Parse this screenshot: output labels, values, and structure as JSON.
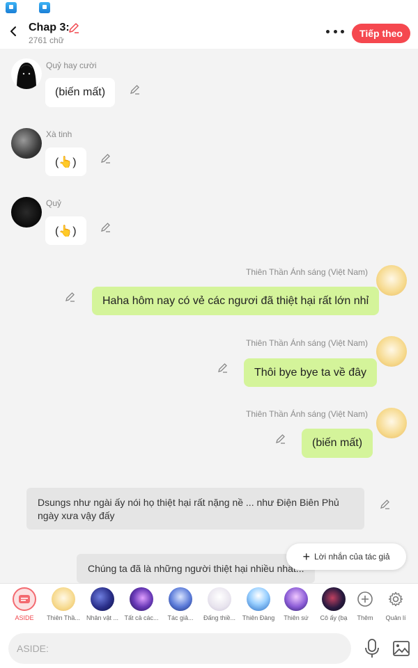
{
  "header": {
    "title": "Chap 3:",
    "word_count": "2761 chữ",
    "next_label": "Tiếp theo"
  },
  "messages": [
    {
      "side": "left",
      "sender": "Quỷ hay cười",
      "text": "(biến mất)",
      "avatar": "dark-ghost-avatar"
    },
    {
      "side": "left",
      "sender": "Xà tinh",
      "text": "(👆)",
      "avatar": "snake-spirit-avatar"
    },
    {
      "side": "left",
      "sender": "Quỷ",
      "text": "(👆)",
      "avatar": "demon-avatar"
    },
    {
      "side": "right",
      "sender": "Thiên Thần Ánh sáng (Việt Nam)",
      "text": "Haha hôm nay có vẻ các ngươi đã thiệt hại rất lớn nhỉ",
      "avatar": "angel-avatar"
    },
    {
      "side": "right",
      "sender": "Thiên Thần Ánh sáng (Việt Nam)",
      "text": "Thôi bye bye ta về đây",
      "avatar": "angel-avatar"
    },
    {
      "side": "right",
      "sender": "Thiên Thần Ánh sáng (Việt Nam)",
      "text": "(biến mất)",
      "avatar": "angel-avatar"
    }
  ],
  "asides": [
    {
      "text": "Dsungs như ngài ấy nói họ thiệt hại rất nặng nề ... như Điện Biên Phủ ngày xưa vậy đấy"
    },
    {
      "text": "Chúng ta đã là những người thiệt hại nhiều nhất..."
    }
  ],
  "author_note_label": "Lời nhắn của tác giả",
  "characters": [
    {
      "label": "ASIDE"
    },
    {
      "label": "Thiên Thầ..."
    },
    {
      "label": "Nhân vật ..."
    },
    {
      "label": "Tất cả các..."
    },
    {
      "label": "Tác giả..."
    },
    {
      "label": "Đấng thiề..."
    },
    {
      "label": "Thiên Đàng"
    },
    {
      "label": "Thiên sứ"
    },
    {
      "label": "Cô ấy (bạ"
    },
    {
      "label": "Thêm"
    },
    {
      "label": "Quản lí"
    }
  ],
  "input": {
    "placeholder": "ASIDE:"
  },
  "colors": {
    "accent": "#f5484f",
    "right_bubble": "#d4f49a",
    "left_bubble": "#ffffff",
    "aside_bubble": "#e5e5e5"
  }
}
